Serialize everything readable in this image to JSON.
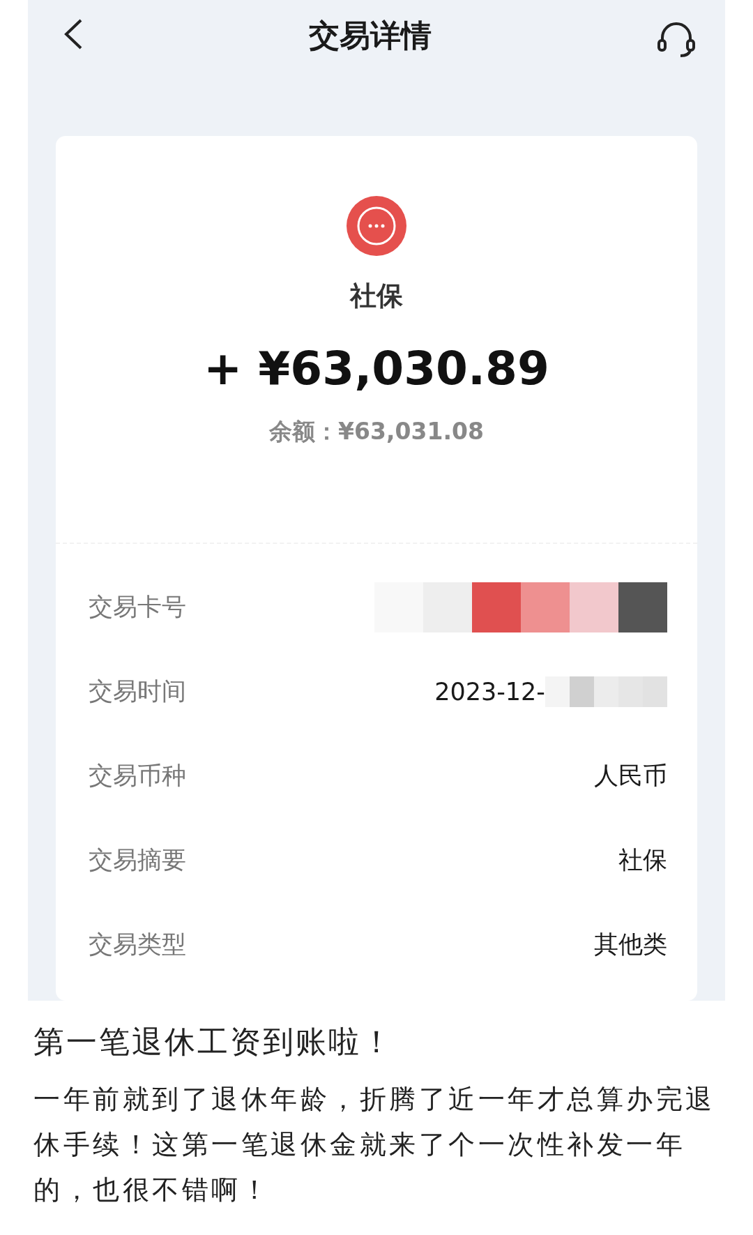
{
  "header": {
    "title": "交易详情"
  },
  "transaction": {
    "name": "社保",
    "amount": "+ ¥63,030.89",
    "balance": "余额：¥63,031.08"
  },
  "details": [
    {
      "label": "交易卡号",
      "redacted": true
    },
    {
      "label": "交易时间",
      "value": "2023-12-",
      "redacted": true
    },
    {
      "label": "交易币种",
      "value": "人民币",
      "redacted": false
    },
    {
      "label": "交易摘要",
      "value": "社保",
      "redacted": false
    },
    {
      "label": "交易类型",
      "value": "其他类",
      "redacted": false
    }
  ],
  "post": {
    "title": "第一笔退休工资到账啦！",
    "body": "一年前就到了退休年龄，折腾了近一年才总算办完退休手续！这第一笔退休金就来了个一次性补发一年的，也很不错啊！"
  }
}
